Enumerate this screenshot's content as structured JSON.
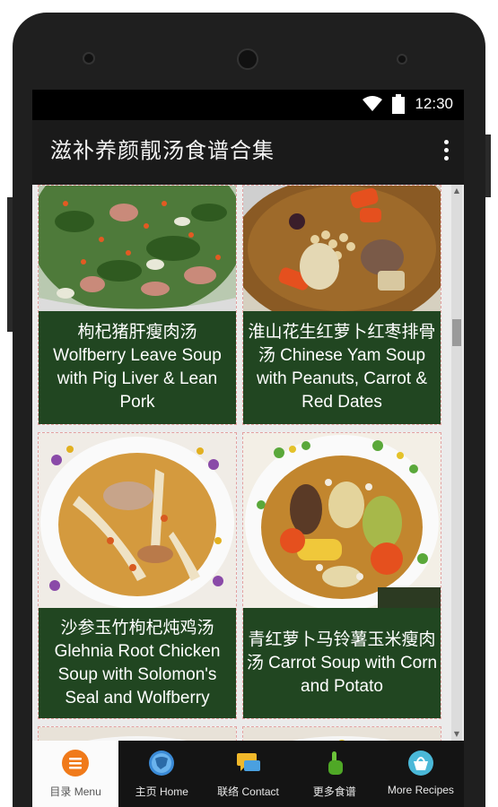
{
  "status": {
    "time": "12:30"
  },
  "app": {
    "title": "滋补养颜靓汤食谱合集"
  },
  "recipes": [
    {
      "caption": "枸杞猪肝瘦肉汤 Wolfberry Leave Soup with Pig Liver & Lean Pork"
    },
    {
      "caption": "淮山花生红萝卜红枣排骨汤 Chinese Yam Soup with Peanuts, Carrot & Red Dates"
    },
    {
      "caption": "沙参玉竹枸杞炖鸡汤 Glehnia Root Chicken Soup with Solomon's Seal and Wolfberry"
    },
    {
      "caption": "青红萝卜马铃薯玉米瘦肉汤 Carrot Soup with Corn and Potato"
    }
  ],
  "nav": [
    {
      "label": "目录 Menu",
      "icon": "menu-icon"
    },
    {
      "label": "主页 Home",
      "icon": "globe-home-icon"
    },
    {
      "label": "联络 Contact",
      "icon": "chat-contact-icon"
    },
    {
      "label": "更多食谱",
      "icon": "hand-pointer-icon"
    },
    {
      "label": "More Recipes",
      "icon": "basket-icon"
    }
  ],
  "colors": {
    "caption_bg": "#0f370f",
    "appbar": "#1a1a1a",
    "accent": "#f07a1a"
  }
}
